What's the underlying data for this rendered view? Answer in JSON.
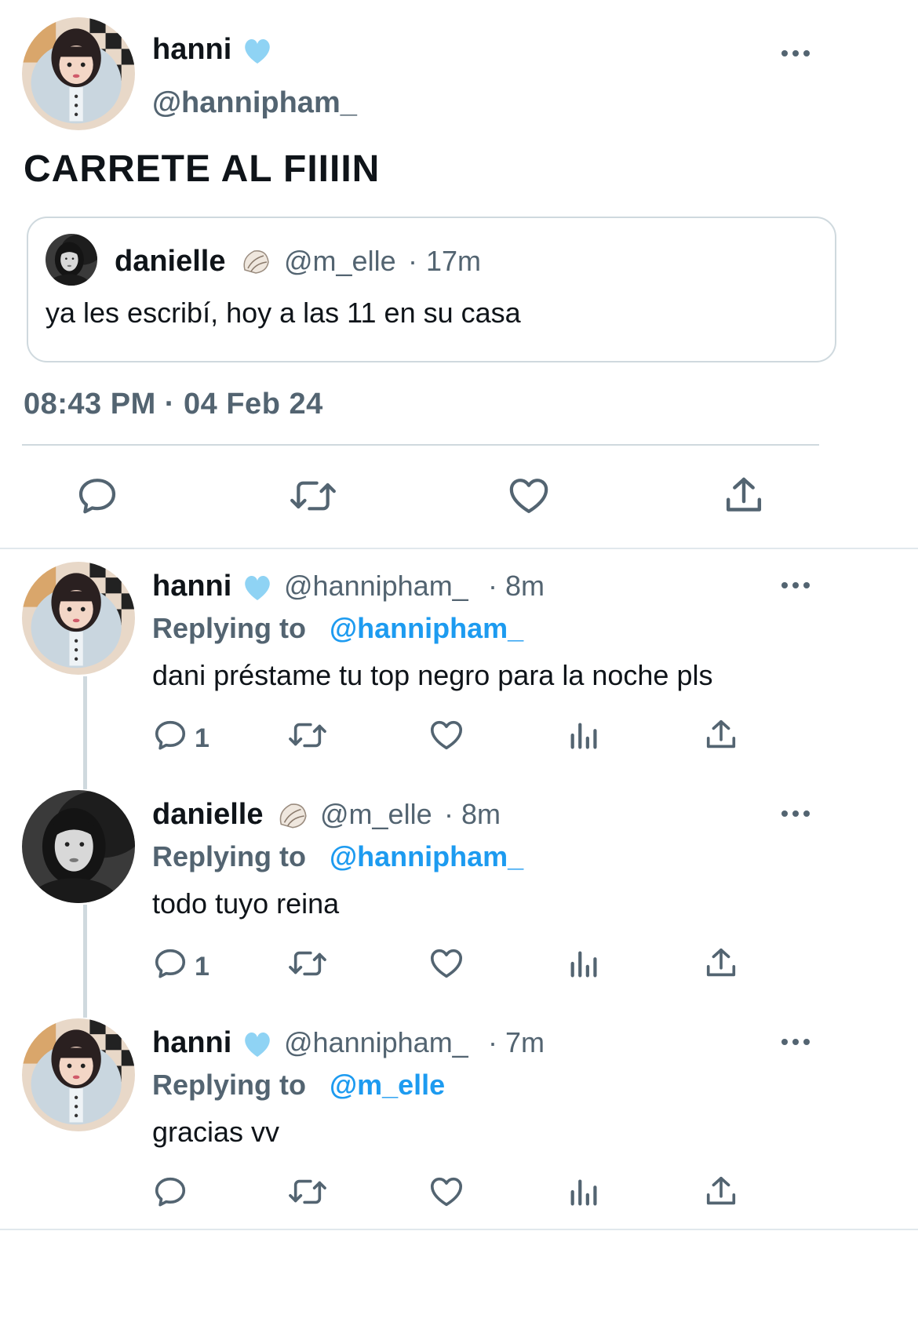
{
  "main_tweet": {
    "display_name": "hanni",
    "badge_icon": "light-blue-heart-icon",
    "handle": "@hannipham_",
    "text": "CARRETE AL FIIIIN",
    "quote": {
      "display_name": "danielle",
      "badge_icon": "shell-icon",
      "handle": "@m_elle",
      "separator": "·",
      "time": "17m",
      "text": "ya les escribí, hoy a las 11 en su casa"
    },
    "timestamp": "08:43 PM · 04 Feb 24",
    "actions": [
      "reply-icon",
      "retweet-icon",
      "like-icon",
      "share-icon"
    ]
  },
  "replies": [
    {
      "display_name": "hanni",
      "badge_icon": "light-blue-heart-icon",
      "handle": "@hannipham_",
      "time_text": "· 8m",
      "replying_label": "Replying to",
      "replying_to": "@hannipham_",
      "text": "dani préstame tu top negro para la noche pls",
      "reply_count": "1"
    },
    {
      "display_name": "danielle",
      "badge_icon": "shell-icon",
      "handle": "@m_elle",
      "time_text": "· 8m",
      "replying_label": "Replying to",
      "replying_to": "@hannipham_",
      "text": "todo tuyo reina",
      "reply_count": "1"
    },
    {
      "display_name": "hanni",
      "badge_icon": "light-blue-heart-icon",
      "handle": "@hannipham_",
      "time_text": "· 7m",
      "replying_label": "Replying to",
      "replying_to": "@m_elle",
      "text": "gracias vv",
      "reply_count": ""
    }
  ],
  "colors": {
    "text": "#0f1419",
    "secondary": "#536471",
    "link": "#1d9bf0",
    "divider": "#cfd9de",
    "heart_badge": "#8fd3f4"
  }
}
